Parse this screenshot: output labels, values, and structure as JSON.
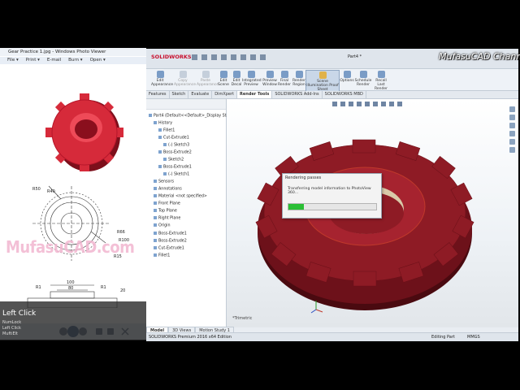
{
  "channel_watermark": "MufasuCAD Channel",
  "photo_viewer": {
    "title": "Gear Practice 1.jpg - Windows Photo Viewer",
    "menu": [
      "File ▾",
      "Print ▾",
      "E-mail",
      "Burn ▾",
      "Open ▾"
    ],
    "watermark": "MufasuCAD.com",
    "dims": [
      "R50",
      "R40",
      "R66",
      "R100",
      "R15",
      "100",
      "80",
      "R1",
      "R1",
      "20",
      "250"
    ]
  },
  "click_overlay": {
    "big": "Left Click",
    "lines": [
      "NumLock",
      "Left Click",
      "MuftiElt"
    ]
  },
  "solidworks": {
    "logo": "SOLIDWORKS",
    "part_label": "Part4 *",
    "ribbon": [
      {
        "label": "Edit Appearance"
      },
      {
        "label": "Copy Appearance"
      },
      {
        "label": "Paste Appearance"
      },
      {
        "label": "Edit Scene"
      },
      {
        "label": "Edit Decal"
      },
      {
        "label": "Integrated Preview"
      },
      {
        "label": "Preview Window"
      },
      {
        "label": "Final Render"
      },
      {
        "label": "Render Region"
      },
      {
        "label": "Schedule Render"
      },
      {
        "label": "Options"
      },
      {
        "label": "Schedule Render"
      },
      {
        "label": "Recall Last Render"
      }
    ],
    "ribbon_highlight": "Scene Illumination Proof Sheet",
    "tabs": [
      "Features",
      "Sketch",
      "Evaluate",
      "DimXpert",
      "Render Tools",
      "SOLIDWORKS Add-Ins",
      "SOLIDWORKS MBD"
    ],
    "active_tab": "Render Tools",
    "tree": [
      "Part4 (Default<<Default>_Display Sta",
      "History",
      "Fillet1",
      "Cut-Extrude1",
      "(-) Sketch3",
      "Boss-Extrude2",
      "Sketch2",
      "Boss-Extrude1",
      "(-) Sketch1",
      "Sensors",
      "Annotations",
      "Material <not specified>",
      "Front Plane",
      "Top Plane",
      "Right Plane",
      "Origin",
      "Boss-Extrude1",
      "Boss-Extrude2",
      "Cut-Extrude1",
      "Fillet1"
    ],
    "dialog": {
      "title": "Rendering passes",
      "message": "Transferring model information to PhotoView 360...",
      "progress": 0.18
    },
    "view_label": "*Trimetric",
    "bottom_tabs": [
      "Model",
      "3D Views",
      "Motion Study 1"
    ],
    "active_bottom_tab": "Model",
    "status_left": "SOLIDWORKS Premium 2016 x64 Edition",
    "status_mid": "Editing Part",
    "status_right": "MMGS",
    "gear_color": "#8e1b25"
  }
}
